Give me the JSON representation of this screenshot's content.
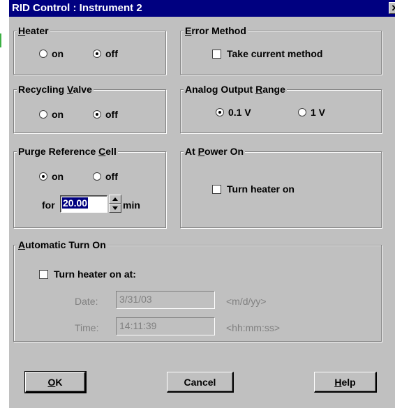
{
  "window": {
    "title": "RID Control : Instrument 2",
    "close_glyph": "✕"
  },
  "heater": {
    "legend_prefix": "",
    "legend_mnemonic": "H",
    "legend_rest": "eater",
    "on_label": "on",
    "off_label": "off",
    "selected": "off"
  },
  "error_method": {
    "legend_prefix": "",
    "legend_mnemonic": "E",
    "legend_rest": "rror Method",
    "checkbox_label": "Take current method",
    "checked": false
  },
  "recycling_valve": {
    "legend_prefix": "Recycling ",
    "legend_mnemonic": "V",
    "legend_rest": "alve",
    "on_label": "on",
    "off_label": "off",
    "selected": "off"
  },
  "analog_output": {
    "legend_prefix": "Analog Output ",
    "legend_mnemonic": "R",
    "legend_rest": "ange",
    "option1_label": "0.1 V",
    "option2_label": "1 V",
    "selected": "0.1 V"
  },
  "purge": {
    "legend_prefix": "Purge Reference ",
    "legend_mnemonic": "C",
    "legend_rest": "ell",
    "on_label": "on",
    "off_label": "off",
    "selected": "on",
    "for_label": "for",
    "value": "20.00",
    "unit_label": "min"
  },
  "power_on": {
    "legend_prefix": "At ",
    "legend_mnemonic": "P",
    "legend_rest": "ower On",
    "checkbox_label": "Turn heater on",
    "checked": false
  },
  "auto_turn_on": {
    "legend_prefix": "",
    "legend_mnemonic": "A",
    "legend_rest": "utomatic Turn On",
    "checkbox_label": "Turn heater on at:",
    "checked": false,
    "date_label": "Date:",
    "date_value": "3/31/03",
    "date_format": "<m/d/yy>",
    "time_label": "Time:",
    "time_value": "14:11:39",
    "time_format": "<hh:mm:ss>"
  },
  "buttons": {
    "ok_mnemonic": "O",
    "ok_rest": "K",
    "cancel_label": "Cancel",
    "help_mnemonic": "H",
    "help_rest": "elp"
  },
  "colors": {
    "titlebar": "#000080",
    "face": "#c0c0c0",
    "highlight": "#000080"
  }
}
